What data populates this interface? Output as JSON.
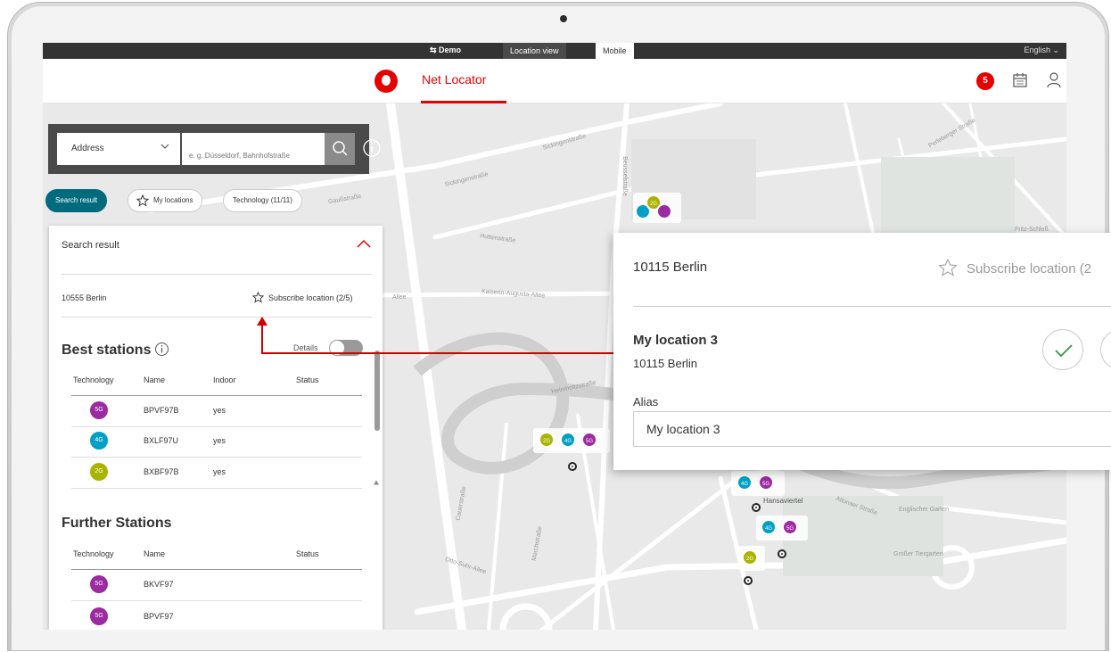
{
  "topbar": {
    "demo_label": "⇆ Demo",
    "tabs": [
      {
        "label": "Location view",
        "active": false
      },
      {
        "label": "Mobile",
        "active": true
      }
    ],
    "language": "English ⌄"
  },
  "header": {
    "app_title": "Net Locator",
    "notification_count": "5",
    "brand_color": "#e60000"
  },
  "search": {
    "type_selected": "Address",
    "placeholder": "e. g. Düsseldorf, Bahnhofstraße"
  },
  "chips": [
    {
      "label": "Search result",
      "active": true
    },
    {
      "label": "My locations",
      "active": false
    },
    {
      "label": "Technology (11/11)",
      "active": false
    }
  ],
  "panel": {
    "heading": "Search result",
    "city": "10555 Berlin",
    "subscribe_label": "Subscribe location (2/5)",
    "best_stations": {
      "title": "Best stations",
      "details_label": "Details",
      "details_on": false,
      "columns": [
        "Technology",
        "Name",
        "Indoor",
        "Status"
      ],
      "rows": [
        {
          "tech": "5G",
          "name": "BPVF97B",
          "indoor": "yes"
        },
        {
          "tech": "4G",
          "name": "BXLF97U",
          "indoor": "yes"
        },
        {
          "tech": "2G",
          "name": "BXBF97B",
          "indoor": "yes"
        }
      ]
    },
    "further_stations": {
      "title": "Further Stations",
      "columns": [
        "Technology",
        "Name",
        "Status"
      ],
      "rows": [
        {
          "tech": "5G",
          "name": "BKVF97"
        },
        {
          "tech": "5G",
          "name": "BPVF97"
        }
      ]
    }
  },
  "tech_colors": {
    "5G": "#9c2aa0",
    "4G": "#00a0c6",
    "2G": "#a8b400"
  },
  "map": {
    "street_labels": [
      "Sickingenstraße",
      "Sickingenstraße",
      "Perleberger Straße",
      "Beusselstraße",
      "Gaußstraße",
      "Huttenstraße",
      "Kaiserin-Augusta-Allee",
      "Helmholtzstraße",
      "Otto-Suhr-Allee",
      "Marchstraße",
      "Cauerstraße",
      "Altonaer Straße",
      "Englischer Garten",
      "Großer Tiergarten",
      "Fritz-Schloß",
      "Allee",
      "Hansaviertel"
    ],
    "markers": [
      {
        "techs": [
          "4G",
          "2G",
          "5G"
        ]
      },
      {
        "techs": [
          "2G",
          "4G",
          "5G"
        ]
      },
      {
        "techs": [
          "4G",
          "5G"
        ]
      },
      {
        "techs": [
          "4G",
          "5G"
        ]
      },
      {
        "techs": [
          "2G"
        ]
      }
    ]
  },
  "popup": {
    "city": "10115 Berlin",
    "subscribe_label": "Subscribe location (2",
    "location_name": "My location 3",
    "location_city": "10115 Berlin",
    "alias_label": "Alias",
    "alias_value": "My location 3"
  }
}
